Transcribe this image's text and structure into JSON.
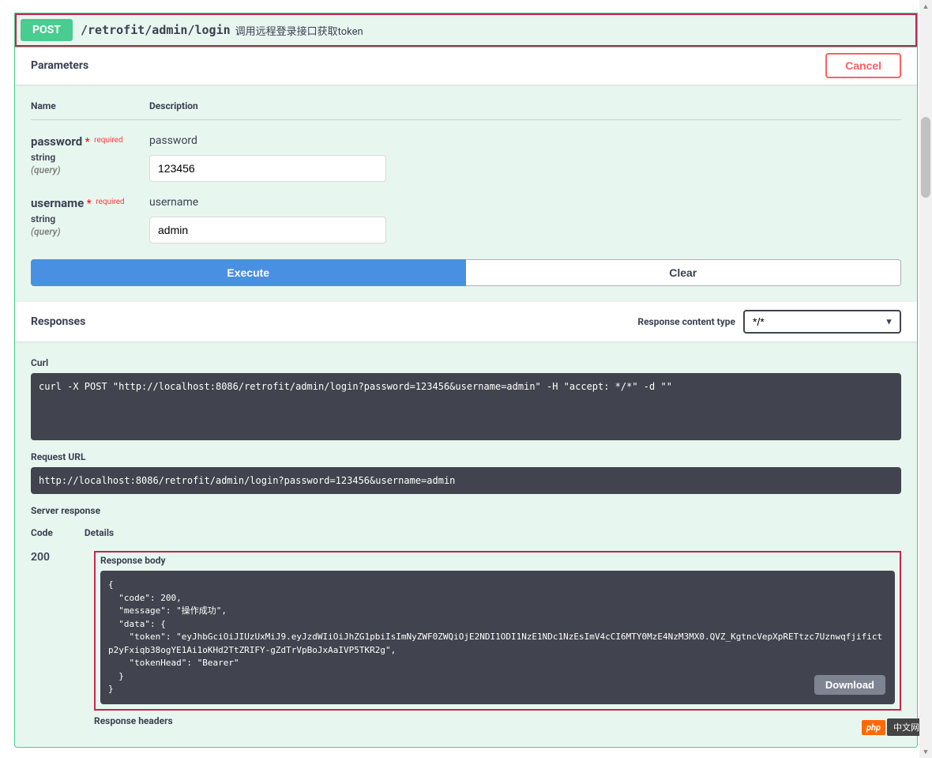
{
  "summary": {
    "method": "POST",
    "path": "/retrofit/admin/login",
    "description": "调用远程登录接口获取token"
  },
  "sections": {
    "parameters_title": "Parameters",
    "cancel": "Cancel",
    "responses_title": "Responses",
    "content_type_label": "Response content type",
    "content_type_value": "*/*"
  },
  "param_headers": {
    "name": "Name",
    "description": "Description"
  },
  "params": [
    {
      "name": "password",
      "required": "required",
      "type": "string",
      "in": "(query)",
      "desc": "password",
      "value": "123456"
    },
    {
      "name": "username",
      "required": "required",
      "type": "string",
      "in": "(query)",
      "desc": "username",
      "value": "admin"
    }
  ],
  "buttons": {
    "execute": "Execute",
    "clear": "Clear",
    "download": "Download"
  },
  "responses": {
    "curl_title": "Curl",
    "curl": "curl -X POST \"http://localhost:8086/retrofit/admin/login?password=123456&username=admin\" -H \"accept: */*\" -d \"\"",
    "request_url_title": "Request URL",
    "request_url": "http://localhost:8086/retrofit/admin/login?password=123456&username=admin",
    "server_response_title": "Server response",
    "code_header": "Code",
    "details_header": "Details",
    "code": "200",
    "response_body_title": "Response body",
    "response_body": "{\n  \"code\": 200,\n  \"message\": \"操作成功\",\n  \"data\": {\n    \"token\": \"eyJhbGciOiJIUzUxMiJ9.eyJzdWIiOiJhZG1pbiIsImNyZWF0ZWQiOjE2NDI1ODI1NzE1NDc1NzEsImV4cCI6MTY0MzE4NzM3MX0.QVZ_KgtncVepXpRETtzc7Uznwqfjifictp2yFxiqb38ogYE1Ai1oKHd2TtZRIFY-gZdTrVpBoJxAaIVP5TKR2g\",\n    \"tokenHead\": \"Bearer\"\n  }\n}",
    "response_headers_title": "Response headers"
  },
  "watermark": {
    "php": "php",
    "cn": "中文网"
  }
}
